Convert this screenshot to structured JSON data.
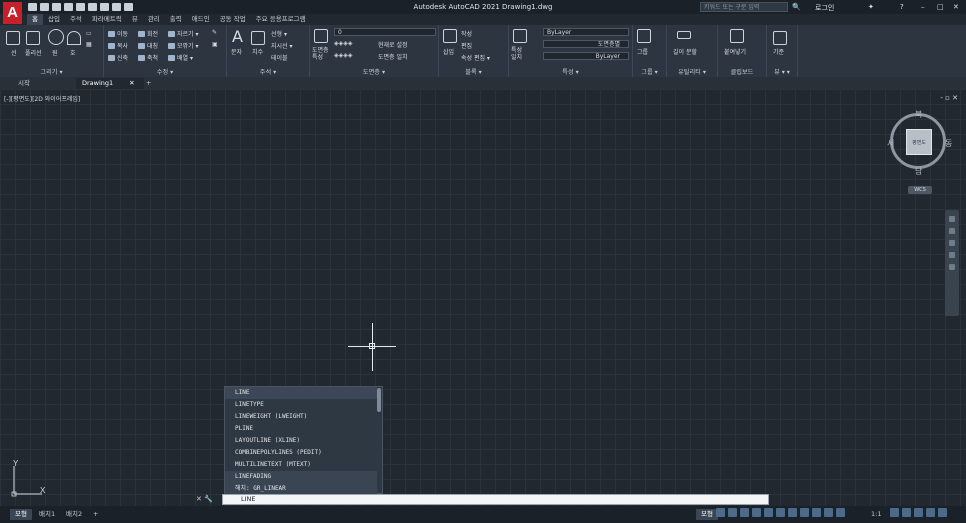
{
  "app": {
    "logo": "A",
    "title": "Autodesk AutoCAD 2021    Drawing1.dwg",
    "search_placeholder": "키워드 또는 구문 입력",
    "login": "로그인"
  },
  "menu": [
    "홈",
    "삽입",
    "주석",
    "파라메트릭",
    "뷰",
    "관리",
    "출력",
    "애드인",
    "공동 작업",
    "주요 응용프로그램"
  ],
  "ribbon": {
    "draw": {
      "title": "그리기 ▾",
      "line": "선",
      "polyline": "폴리선",
      "circle": "원",
      "arc": "호"
    },
    "modify": {
      "title": "수정 ▾",
      "move": "이동",
      "rotate": "회전",
      "trim": "자르기 ▾",
      "copy": "복사",
      "mirror": "대칭",
      "fillet": "모깎기 ▾",
      "stretch": "신축",
      "scale": "축척",
      "array": "배열 ▾"
    },
    "annotation": {
      "title": "주석 ▾",
      "text": "문자",
      "dimension": "치수",
      "linear": "선형 ▾",
      "leader": "지시선 ▾",
      "table": "테이블"
    },
    "layers": {
      "title": "도면층 ▾",
      "props": "도면층 특성",
      "current_layer": "0",
      "make_current": "현재로 설정",
      "match": "도면층 일치"
    },
    "block": {
      "title": "블록 ▾",
      "insert": "삽입",
      "create": "작성",
      "edit": "편집",
      "edit_attr": "속성 편집 ▾"
    },
    "properties": {
      "title": "특성 ▾",
      "match": "특성 일치",
      "color": "ByLayer",
      "lineweight": "도면층별",
      "linetype": "ByLayer"
    },
    "groups": {
      "title": "그룹 ▾",
      "group": "그룹"
    },
    "utilities": {
      "title": "유틸리티 ▾",
      "measure": "길이 분할"
    },
    "clipboard": {
      "title": "클립보드",
      "paste": "붙여넣기"
    },
    "view": {
      "title": "뷰 ▾ ▾",
      "base": "기준"
    }
  },
  "doc_tabs": [
    "시작",
    "Drawing1"
  ],
  "viewport": {
    "label": "[-][평면도][2D 와이어프레임]",
    "controls": "- ▫ ✕",
    "viewcube": {
      "face": "평면도",
      "north": "북",
      "south": "남",
      "east": "동",
      "west": "서",
      "wcs": "WCS"
    }
  },
  "autocomplete": {
    "items": [
      "LINE",
      "LINETYPE",
      "LINEWEIGHT (LWEIGHT)",
      "PLINE",
      "LAYOUTLINE (XLINE)",
      "COMBINEPOLYLINES (PEDIT)",
      "MULTILINETEXT (MTEXT)"
    ],
    "sections": [
      "LINEFADING",
      "해치: GR_LINEAR"
    ]
  },
  "command_line": {
    "value": "LINE"
  },
  "ucs": {
    "x": "X",
    "y": "Y"
  },
  "layout_tabs": [
    "모형",
    "배치1",
    "배치2",
    "+"
  ],
  "status": {
    "mode": "모형",
    "scale": "1:1"
  }
}
